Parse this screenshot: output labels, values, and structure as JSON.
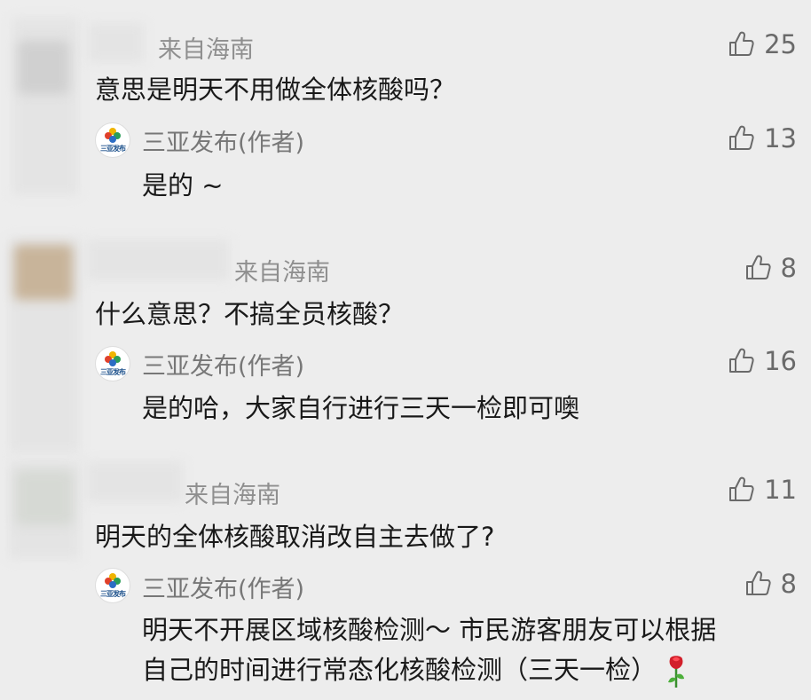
{
  "comments": [
    {
      "origin": "来自海南",
      "likes": "25",
      "text": "意思是明天不用做全体核酸吗？",
      "reply": {
        "author": "三亚发布(作者)",
        "logo_text": "三亚发布",
        "likes": "13",
        "text": "是的 ~"
      }
    },
    {
      "origin": "来自海南",
      "likes": "8",
      "text": "什么意思？不搞全员核酸？",
      "reply": {
        "author": "三亚发布(作者)",
        "logo_text": "三亚发布",
        "likes": "16",
        "text": "是的哈，大家自行进行三天一检即可噢"
      }
    },
    {
      "origin": "来自海南",
      "likes": "11",
      "text": "明天的全体核酸取消改自主去做了?",
      "reply": {
        "author": "三亚发布(作者)",
        "logo_text": "三亚发布",
        "likes": "8",
        "text_line1": "明天不开展区域核酸检测～ 市民游客朋友可以根据",
        "text_line2": "自己的时间进行常态化核酸检测（三天一检）"
      }
    }
  ],
  "icons": {
    "like": "thumbs-up-icon",
    "rose": "rose-emoji-icon"
  },
  "colors": {
    "background": "#ededed",
    "text": "#191919",
    "secondary": "#8f8f8f"
  }
}
